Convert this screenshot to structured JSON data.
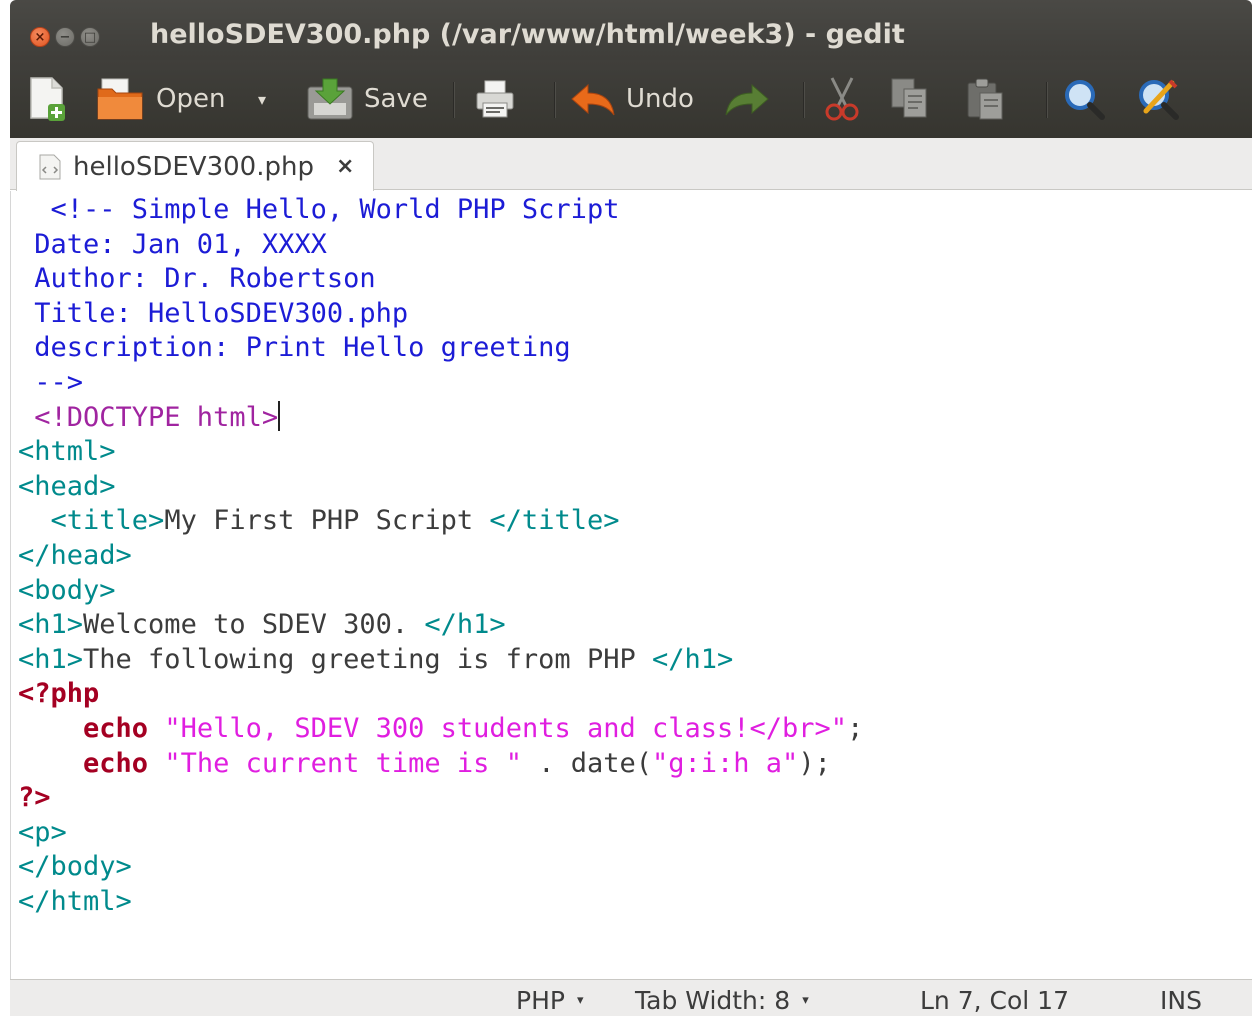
{
  "window": {
    "title": "helloSDEV300.php (/var/www/html/week3) - gedit",
    "buttons": {
      "close": "×",
      "minimize": "−",
      "maximize": "□"
    }
  },
  "toolbar": {
    "new_icon": "new-document-icon",
    "open_label": "Open",
    "open_dropdown": "▾",
    "save_label": "Save",
    "print_icon": "printer-icon",
    "undo_label": "Undo",
    "redo_icon": "redo-icon",
    "cut_icon": "scissors-icon",
    "copy_icon": "copy-icon",
    "paste_icon": "paste-icon",
    "search_icon": "search-icon",
    "replace_icon": "search-replace-icon"
  },
  "tabs": [
    {
      "label": "helloSDEV300.php",
      "close": "×",
      "icon": "php-file-icon"
    }
  ],
  "editor": {
    "lines": [
      [
        {
          "t": "  <!-- Simple Hello, World PHP Script",
          "c": "comment"
        }
      ],
      [
        {
          "t": " Date: Jan 01, XXXX",
          "c": "comment"
        }
      ],
      [
        {
          "t": " Author: Dr. Robertson",
          "c": "comment"
        }
      ],
      [
        {
          "t": " Title: HelloSDEV300.php",
          "c": "comment"
        }
      ],
      [
        {
          "t": " description: Print Hello greeting",
          "c": "comment"
        }
      ],
      [
        {
          "t": " -->",
          "c": "comment"
        }
      ],
      [
        {
          "t": " <!DOCTYPE html>",
          "c": "doctype"
        },
        {
          "t": "",
          "c": "cursor"
        }
      ],
      [
        {
          "t": "<html>",
          "c": "tag"
        }
      ],
      [
        {
          "t": "<head>",
          "c": "tag"
        }
      ],
      [
        {
          "t": "  <title>",
          "c": "tag"
        },
        {
          "t": "My First PHP Script ",
          "c": "text"
        },
        {
          "t": "</title>",
          "c": "tag"
        }
      ],
      [
        {
          "t": "</head>",
          "c": "tag"
        }
      ],
      [
        {
          "t": "<body>",
          "c": "tag"
        }
      ],
      [
        {
          "t": "<h1>",
          "c": "tag"
        },
        {
          "t": "Welcome to SDEV 300. ",
          "c": "text"
        },
        {
          "t": "</h1>",
          "c": "tag"
        }
      ],
      [
        {
          "t": "<h1>",
          "c": "tag"
        },
        {
          "t": "The following greeting is from PHP ",
          "c": "text"
        },
        {
          "t": "</h1>",
          "c": "tag"
        }
      ],
      [
        {
          "t": "<?php",
          "c": "php"
        }
      ],
      [
        {
          "t": "    ",
          "c": "plain"
        },
        {
          "t": "echo",
          "c": "php"
        },
        {
          "t": " ",
          "c": "plain"
        },
        {
          "t": "\"Hello, SDEV 300 students and class!</br>\"",
          "c": "str"
        },
        {
          "t": ";",
          "c": "plain"
        }
      ],
      [
        {
          "t": "    ",
          "c": "plain"
        },
        {
          "t": "echo",
          "c": "php"
        },
        {
          "t": " ",
          "c": "plain"
        },
        {
          "t": "\"The current time is \"",
          "c": "str"
        },
        {
          "t": " . date(",
          "c": "plain"
        },
        {
          "t": "\"g:i:h a\"",
          "c": "str"
        },
        {
          "t": ");",
          "c": "plain"
        }
      ],
      [
        {
          "t": "?>",
          "c": "php"
        }
      ],
      [
        {
          "t": "<p>",
          "c": "tag"
        }
      ],
      [
        {
          "t": "</body>",
          "c": "tag"
        }
      ],
      [
        {
          "t": "</html>",
          "c": "tag"
        }
      ]
    ]
  },
  "statusbar": {
    "language": "PHP",
    "tab_width": "Tab Width: 8",
    "dropdown_arrow": "▾",
    "position": "Ln 7, Col 17",
    "mode": "INS"
  },
  "colors": {
    "comment": "#1c1cd6",
    "doctype": "#a024a0",
    "tag": "#008a8c",
    "text": "#3c3c3c",
    "php_keyword": "#a40022",
    "string": "#e01ee0",
    "titlebar": "#3c3b37",
    "close_button": "#e05420"
  }
}
